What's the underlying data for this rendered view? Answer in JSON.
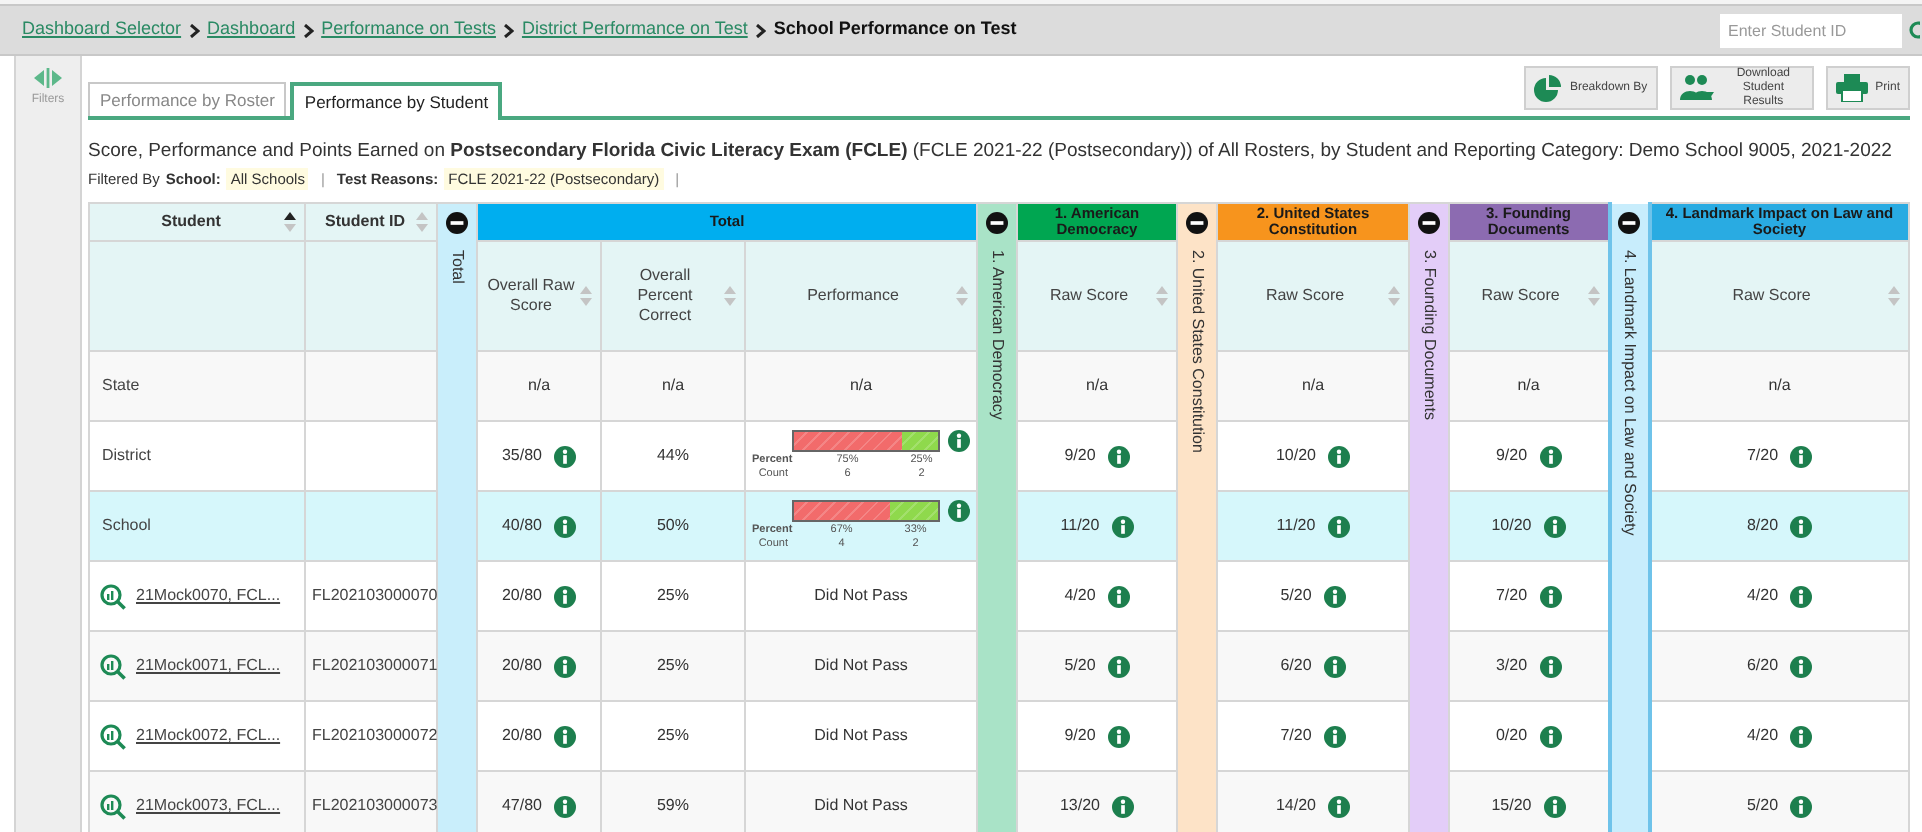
{
  "breadcrumbs": [
    {
      "label": "Dashboard Selector",
      "kind": "link"
    },
    {
      "label": "Dashboard",
      "kind": "link"
    },
    {
      "label": "Performance on Tests",
      "kind": "link"
    },
    {
      "label": "District Performance on Test",
      "kind": "link"
    },
    {
      "label": "School Performance on Test",
      "kind": "current"
    }
  ],
  "student_search": {
    "placeholder": "Enter Student ID"
  },
  "sidebar": {
    "filters_label": "Filters"
  },
  "tabs": [
    {
      "label": "Performance by Roster",
      "selected": false
    },
    {
      "label": "Performance by Student",
      "selected": true
    }
  ],
  "toolbar_buttons": [
    {
      "kind": "breakdown",
      "label": "Breakdown By"
    },
    {
      "kind": "download",
      "label": "Download Student Results"
    },
    {
      "kind": "print",
      "label": "Print"
    }
  ],
  "report_title": "Score, Performance and Points Earned on **Postsecondary Florida Civic Literacy Exam (FCLE)** (FCLE 2021-22 (Postsecondary)) of All Rosters, by Student and Reporting Category: Demo School 9005, 2021-2022",
  "filter_summary": {
    "label": "Filtered By",
    "items": [
      {
        "label": "School:",
        "value": "All Schools",
        "separator": "|"
      },
      {
        "label": "Test Reasons:",
        "value": "FCLE 2021-22 (Postsecondary)",
        "separator": "|"
      }
    ]
  },
  "table": {
    "columns": [
      {
        "label": "Student",
        "sorted": true
      },
      {
        "label": "Student ID",
        "sorted": false
      }
    ],
    "groups": [
      {
        "title": "Total",
        "color": "#00aeef",
        "strip": {
          "label": "Total",
          "color": "#c9eefb"
        },
        "columns": [
          {
            "label": "Overall Raw Score",
            "sorted": false
          },
          {
            "label": "Overall Percent Correct",
            "sorted": false
          },
          {
            "label": "Performance",
            "sorted": false
          }
        ]
      },
      {
        "title": "1. American Democracy",
        "color": "#00a651",
        "strip": {
          "label": "1. American Democracy",
          "color": "#a9e3c7"
        },
        "columns": [
          {
            "label": "Raw Score",
            "sorted": false
          }
        ]
      },
      {
        "title": "2. United States Constitution",
        "color": "#f7941d",
        "strip": {
          "label": "2. United States Constitution",
          "color": "#fde3c7"
        },
        "columns": [
          {
            "label": "Raw Score",
            "sorted": false
          }
        ]
      },
      {
        "title": "3. Founding Documents",
        "color": "#8c6bb1",
        "strip": {
          "label": "3. Founding Documents",
          "color": "#e3cdf8"
        },
        "columns": [
          {
            "label": "Raw Score",
            "sorted": false
          }
        ]
      },
      {
        "title": "4. Landmark Impact on Law and Society",
        "color": "#29abe2",
        "strip": {
          "label": "4. Landmark Impact on Law and Society",
          "color": "#c8edfc"
        },
        "columns": [
          {
            "label": "Raw Score",
            "sorted": false
          }
        ]
      }
    ],
    "rows": [
      {
        "kind": "aggregate",
        "label": "State",
        "highlighted": false,
        "raw_score": {
          "value": "n/a",
          "info": false
        },
        "percent_correct": "n/a",
        "performance": {
          "kind": "text",
          "value": "n/a"
        },
        "category_scores": [
          {
            "value": "n/a",
            "info": false
          },
          {
            "value": "n/a",
            "info": false
          },
          {
            "value": "n/a",
            "info": false
          },
          {
            "value": "n/a",
            "info": false
          }
        ]
      },
      {
        "kind": "aggregate",
        "label": "District",
        "highlighted": false,
        "raw_score": {
          "value": "35/80",
          "info": true
        },
        "percent_correct": "44%",
        "performance": {
          "kind": "bar",
          "percent_label": "Percent",
          "count_label": "Count",
          "info": true,
          "segments": [
            {
              "level": 0.75,
              "percent": "75%",
              "count": "6",
              "color": "#f26b6b"
            },
            {
              "level": 0.25,
              "percent": "25%",
              "count": "2",
              "color": "#8fd94c"
            }
          ]
        },
        "category_scores": [
          {
            "value": "9/20",
            "info": true
          },
          {
            "value": "10/20",
            "info": true
          },
          {
            "value": "9/20",
            "info": true
          },
          {
            "value": "7/20",
            "info": true
          }
        ]
      },
      {
        "kind": "aggregate",
        "label": "School",
        "highlighted": true,
        "raw_score": {
          "value": "40/80",
          "info": true
        },
        "percent_correct": "50%",
        "performance": {
          "kind": "bar",
          "percent_label": "Percent",
          "count_label": "Count",
          "info": true,
          "segments": [
            {
              "level": 0.67,
              "percent": "67%",
              "count": "4",
              "color": "#f26b6b"
            },
            {
              "level": 0.33,
              "percent": "33%",
              "count": "2",
              "color": "#8fd94c"
            }
          ]
        },
        "category_scores": [
          {
            "value": "11/20",
            "info": true
          },
          {
            "value": "11/20",
            "info": true
          },
          {
            "value": "10/20",
            "info": true
          },
          {
            "value": "8/20",
            "info": true
          }
        ]
      },
      {
        "kind": "student",
        "label": "21Mock0070, FCL...",
        "student_id": "FL202103000070",
        "highlighted": false,
        "raw_score": {
          "value": "20/80",
          "info": true
        },
        "percent_correct": "25%",
        "performance": {
          "kind": "text",
          "value": "Did Not Pass"
        },
        "category_scores": [
          {
            "value": "4/20",
            "info": true
          },
          {
            "value": "5/20",
            "info": true
          },
          {
            "value": "7/20",
            "info": true
          },
          {
            "value": "4/20",
            "info": true
          }
        ]
      },
      {
        "kind": "student",
        "label": "21Mock0071, FCL...",
        "student_id": "FL202103000071",
        "highlighted": false,
        "raw_score": {
          "value": "20/80",
          "info": true
        },
        "percent_correct": "25%",
        "performance": {
          "kind": "text",
          "value": "Did Not Pass"
        },
        "category_scores": [
          {
            "value": "5/20",
            "info": true
          },
          {
            "value": "6/20",
            "info": true
          },
          {
            "value": "3/20",
            "info": true
          },
          {
            "value": "6/20",
            "info": true
          }
        ]
      },
      {
        "kind": "student",
        "label": "21Mock0072, FCL...",
        "student_id": "FL202103000072",
        "highlighted": false,
        "raw_score": {
          "value": "20/80",
          "info": true
        },
        "percent_correct": "25%",
        "performance": {
          "kind": "text",
          "value": "Did Not Pass"
        },
        "category_scores": [
          {
            "value": "9/20",
            "info": true
          },
          {
            "value": "7/20",
            "info": true
          },
          {
            "value": "0/20",
            "info": true
          },
          {
            "value": "4/20",
            "info": true
          }
        ]
      },
      {
        "kind": "student",
        "label": "21Mock0073, FCL...",
        "student_id": "FL202103000073",
        "highlighted": false,
        "raw_score": {
          "value": "47/80",
          "info": true
        },
        "percent_correct": "59%",
        "performance": {
          "kind": "text",
          "value": "Did Not Pass"
        },
        "category_scores": [
          {
            "value": "13/20",
            "info": true
          },
          {
            "value": "14/20",
            "info": true
          },
          {
            "value": "15/20",
            "info": true
          },
          {
            "value": "5/20",
            "info": true
          }
        ]
      }
    ]
  }
}
